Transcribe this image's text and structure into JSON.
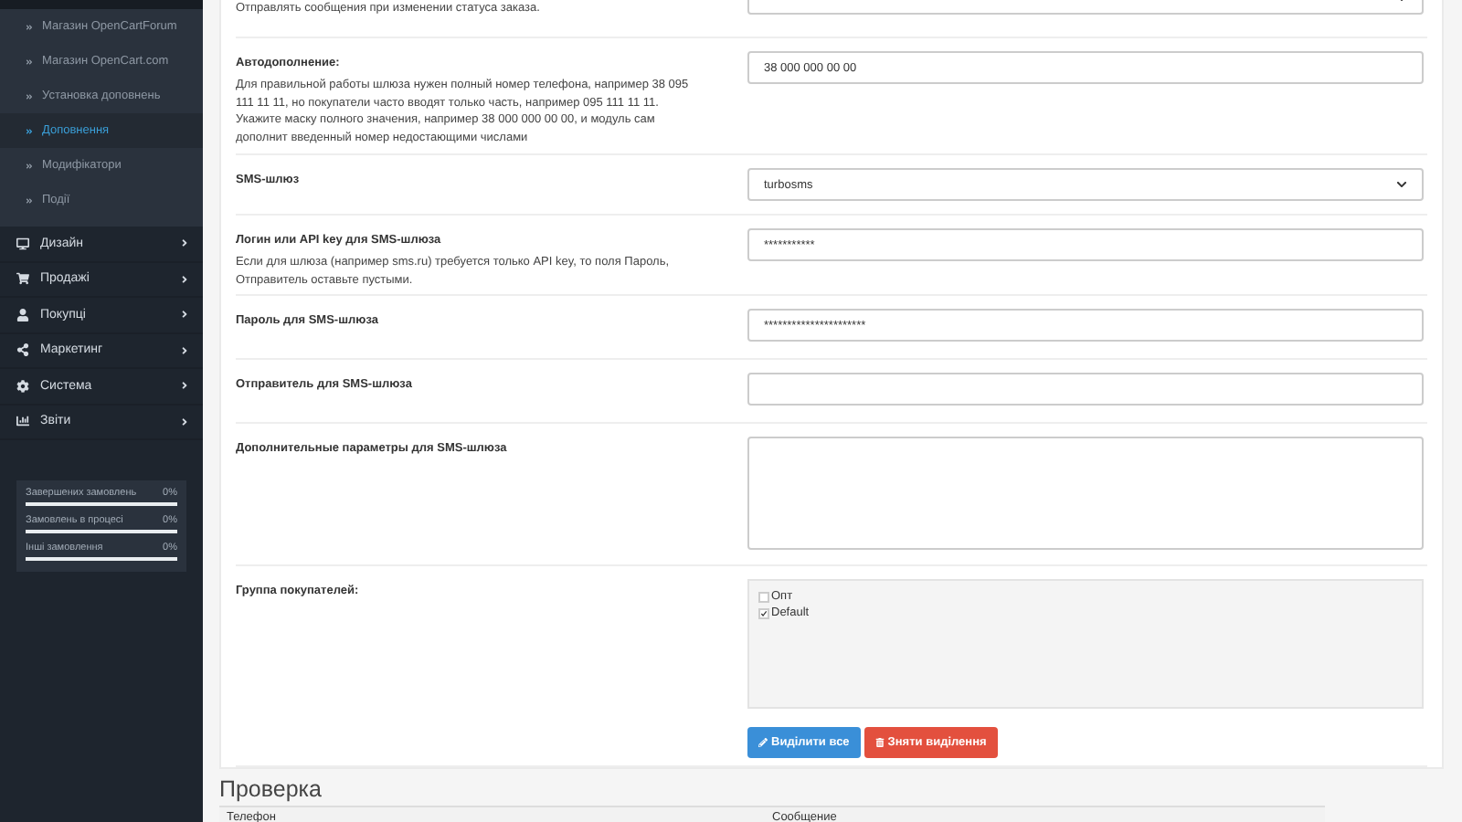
{
  "sidebar": {
    "submenu": [
      {
        "label": "Магазин OpenCartForum",
        "selected": false
      },
      {
        "label": "Магазин OpenCart.com",
        "selected": false
      },
      {
        "label": "Установка доповнень",
        "selected": false
      },
      {
        "label": "Доповнення",
        "selected": true
      },
      {
        "label": "Модифікатори",
        "selected": false
      },
      {
        "label": "Події",
        "selected": false
      }
    ],
    "menu": [
      {
        "label": "Дизайн"
      },
      {
        "label": "Продажі"
      },
      {
        "label": "Покупці"
      },
      {
        "label": "Маркетинг"
      },
      {
        "label": "Система"
      },
      {
        "label": "Звіти"
      }
    ],
    "stats": [
      {
        "label": "Завершених замовлень",
        "value": "0%"
      },
      {
        "label": "Замовлень в процесі",
        "value": "0%"
      },
      {
        "label": "Інші замовлення",
        "value": "0%"
      }
    ]
  },
  "form": {
    "rows": [
      {
        "kind": "select",
        "description": "Отправлять сообщения при изменении статуса заказа."
      },
      {
        "kind": "input",
        "label": "Автодополнение:",
        "description": "Для правильной работы шлюза нужен полный номер телефона, например 38 095 111 11 11, но покупатели часто вводят только часть, например 095 111 11 11. Укажите маску полного значения, например 38 000 000 00 00, и модуль сам дополнит введенный номер недостающими числами",
        "value": "38 000 000 00 00"
      },
      {
        "kind": "select",
        "label": "SMS-шлюз",
        "value": "turbosms"
      },
      {
        "kind": "input",
        "label": "Логин или API key для SMS-шлюза",
        "description": "Если для шлюза (например sms.ru) требуется только API key, то поля Пароль, Отправитель оставьте пустыми.",
        "value": "***********"
      },
      {
        "kind": "input",
        "label": "Пароль для SMS-шлюза",
        "value": "**********************"
      },
      {
        "kind": "input",
        "label": "Отправитель для SMS-шлюза"
      },
      {
        "kind": "textarea",
        "label": "Дополнительные параметры для SMS-шлюза"
      },
      {
        "kind": "checklist",
        "label": "Группа покупателей:",
        "options": [
          {
            "label": "Опт",
            "checked": false
          },
          {
            "label": "Default",
            "checked": true
          }
        ],
        "buttons": [
          {
            "label": "Виділити все",
            "kind": "primary"
          },
          {
            "label": "Зняти виділення",
            "kind": "danger"
          }
        ]
      }
    ]
  },
  "check": {
    "title": "Проверка",
    "columns": [
      "Телефон",
      "Сообщение"
    ]
  }
}
